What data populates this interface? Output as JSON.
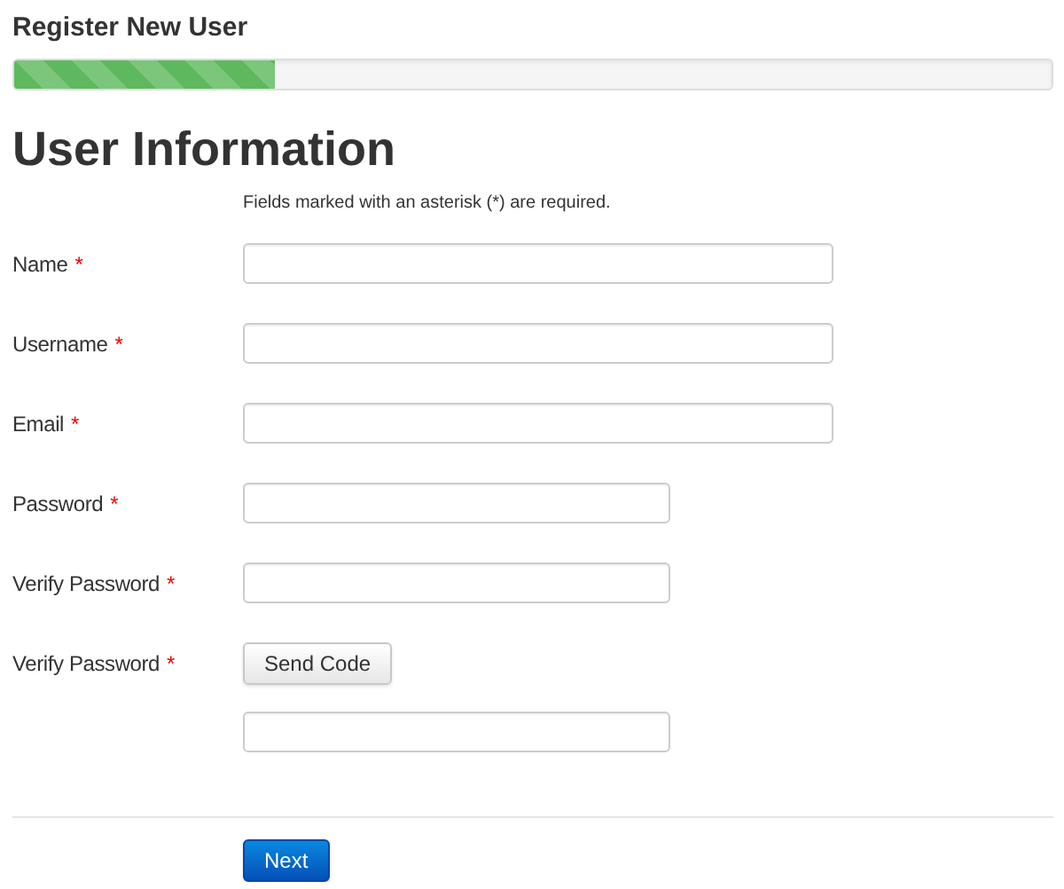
{
  "header": {
    "title": "Register New User"
  },
  "progress": {
    "level": 0.252
  },
  "section": {
    "heading": "User Information",
    "note": "Fields marked with an asterisk (*) are required."
  },
  "fields": [
    {
      "label": "Name",
      "required_mark": "*",
      "controls": [
        {
          "kind": "wide"
        }
      ]
    },
    {
      "label": "Username",
      "required_mark": "*",
      "controls": [
        {
          "kind": "wide"
        }
      ]
    },
    {
      "label": "Email",
      "required_mark": "*",
      "controls": [
        {
          "kind": "wide"
        }
      ]
    },
    {
      "label": "Password",
      "required_mark": "*",
      "controls": [
        {
          "kind": "narrow"
        }
      ]
    },
    {
      "label": "Verify Password",
      "required_mark": "*",
      "controls": [
        {
          "kind": "narrow"
        }
      ]
    },
    {
      "label": "Verify Password",
      "required_mark": "*",
      "controls": [
        {
          "kind": "button",
          "label": "Send Code"
        },
        {
          "kind": "narrow"
        }
      ]
    }
  ],
  "actions": [
    {
      "kind": "primary",
      "label": "Next"
    }
  ]
}
